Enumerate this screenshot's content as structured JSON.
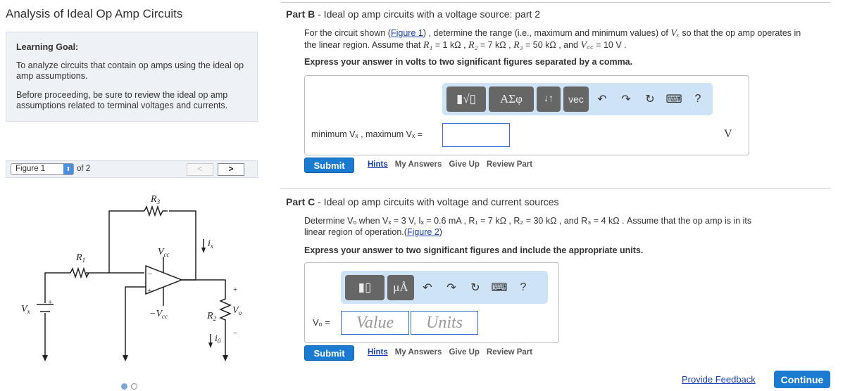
{
  "left": {
    "title": "Analysis of Ideal Op Amp Circuits",
    "goal_heading": "Learning Goal:",
    "goal_text": "To analyze circuits that contain op amps using the ideal op amp assumptions.",
    "goal_text2": "Before proceeding, be sure to review the ideal op amp assumptions related to terminal voltages and currents.",
    "figure_select": "Figure 1",
    "figure_of": "of 2",
    "prev": "<",
    "next": ">",
    "circuit": {
      "R1": "R",
      "R1s": "1",
      "R2": "R",
      "R2s": "2",
      "R3": "R",
      "R3s": "3",
      "Vcc": "V",
      "Vccs": "cc",
      "mVcc": "−V",
      "mVccs": "cc",
      "Vx": "V",
      "Vxs": "x",
      "Vo": "V",
      "Vos": "o",
      "ix": "i",
      "ixs": "x",
      "io": "i",
      "ios": "0",
      "plus": "+",
      "minus": "−"
    }
  },
  "partB": {
    "label": "Part B",
    "title": " - Ideal op amp circuits with a voltage source: part 2",
    "q1": "For the circuit shown (",
    "fig": "Figure 1",
    "q2": ") , determine the range (i.e., maximum and minimum values) of ",
    "vx": "Vₓ",
    "q3": " so that the op amp operates in",
    "q4": "the linear region. Assume that ",
    "r1": "R₁",
    "q5": " = 1 kΩ , ",
    "r2": "R₂",
    "q6": " = 7 kΩ , ",
    "r3": "R₃",
    "q7": " = 50 kΩ , and ",
    "vcc": "V꜀꜀",
    "q8": " = 10 V .",
    "instr": "Express your answer in volts to two significant figures separated by a comma.",
    "answer_label": "minimum Vₓ , maximum Vₓ =",
    "unit": "V",
    "toolbar": [
      "▮√▯",
      "ΑΣφ",
      "↓↑",
      "vec",
      "↶",
      "↷",
      "↻",
      "⌨",
      "?"
    ]
  },
  "partC": {
    "label": "Part C",
    "title": " - Ideal op amp circuits with voltage and current sources",
    "q1": "Determine Vₒ when Vₓ = 3 V, Iₓ = 0.6 mA , R₁ = 7 kΩ , R₂ = 30 kΩ , and R₃ = 4 kΩ . Assume that the op amp is in its",
    "q2": "linear region of operation.(",
    "fig": "Figure 2",
    "q3": ")",
    "instr": "Express your answer to two significant figures and include the appropriate units.",
    "answer_label": "Vₒ =",
    "value_ph": "Value",
    "units_ph": "Units",
    "toolbar": [
      "▮▯",
      "μÅ",
      "↶",
      "↷",
      "↻",
      "⌨",
      "?"
    ]
  },
  "actions": {
    "submit": "Submit",
    "hints": "Hints",
    "my_answers": "My Answers",
    "give_up": "Give Up",
    "review": "Review Part"
  },
  "footer": {
    "feedback": "Provide Feedback",
    "continue": "Continue"
  }
}
